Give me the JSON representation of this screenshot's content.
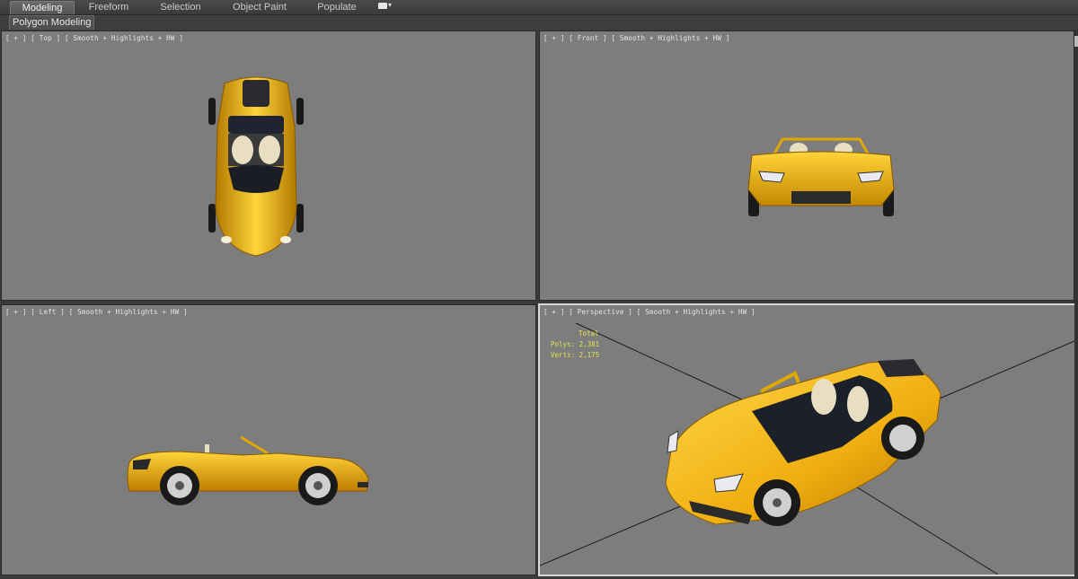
{
  "ribbon": {
    "tabs": [
      {
        "label": "Modeling",
        "active": true
      },
      {
        "label": "Freeform",
        "active": false
      },
      {
        "label": "Selection",
        "active": false
      },
      {
        "label": "Object Paint",
        "active": false
      },
      {
        "label": "Populate",
        "active": false
      }
    ],
    "extra_icon": "panel-options-icon"
  },
  "subbar": {
    "active_tab": "Polygon Modeling"
  },
  "viewports": {
    "top": {
      "label": "[ + ] [ Top ] [ Smooth + Highlights + HW ]"
    },
    "front": {
      "label": "[ + ] [ Front ] [ Smooth + Highlights + HW ]"
    },
    "left": {
      "label": "[ + ] [ Left ] [ Smooth + Highlights + HW ]"
    },
    "perspective": {
      "label": "[ + ] [ Perspective ] [ Smooth + Highlights + HW ]",
      "stats": {
        "title": "Total",
        "polys_label": "Polys:",
        "polys_value": "2,381",
        "verts_label": "Verts:",
        "verts_value": "2,175"
      }
    }
  },
  "colors": {
    "viewport_bg": "#7d7d7d",
    "car_yellow": "#f2b20f",
    "stats_text": "#e3e34a",
    "interior_cream": "#e8dfc2"
  }
}
